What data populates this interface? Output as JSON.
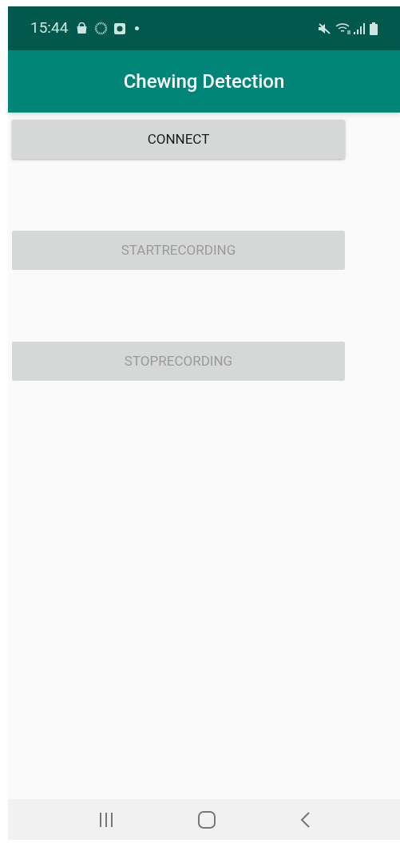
{
  "status_bar": {
    "time": "15:44"
  },
  "app_bar": {
    "title": "Chewing Detection"
  },
  "buttons": [
    {
      "label": "CONNECT",
      "disabled": false
    },
    {
      "label": "STARTRECORDING",
      "disabled": true
    },
    {
      "label": "STOPRECORDING",
      "disabled": true
    }
  ]
}
